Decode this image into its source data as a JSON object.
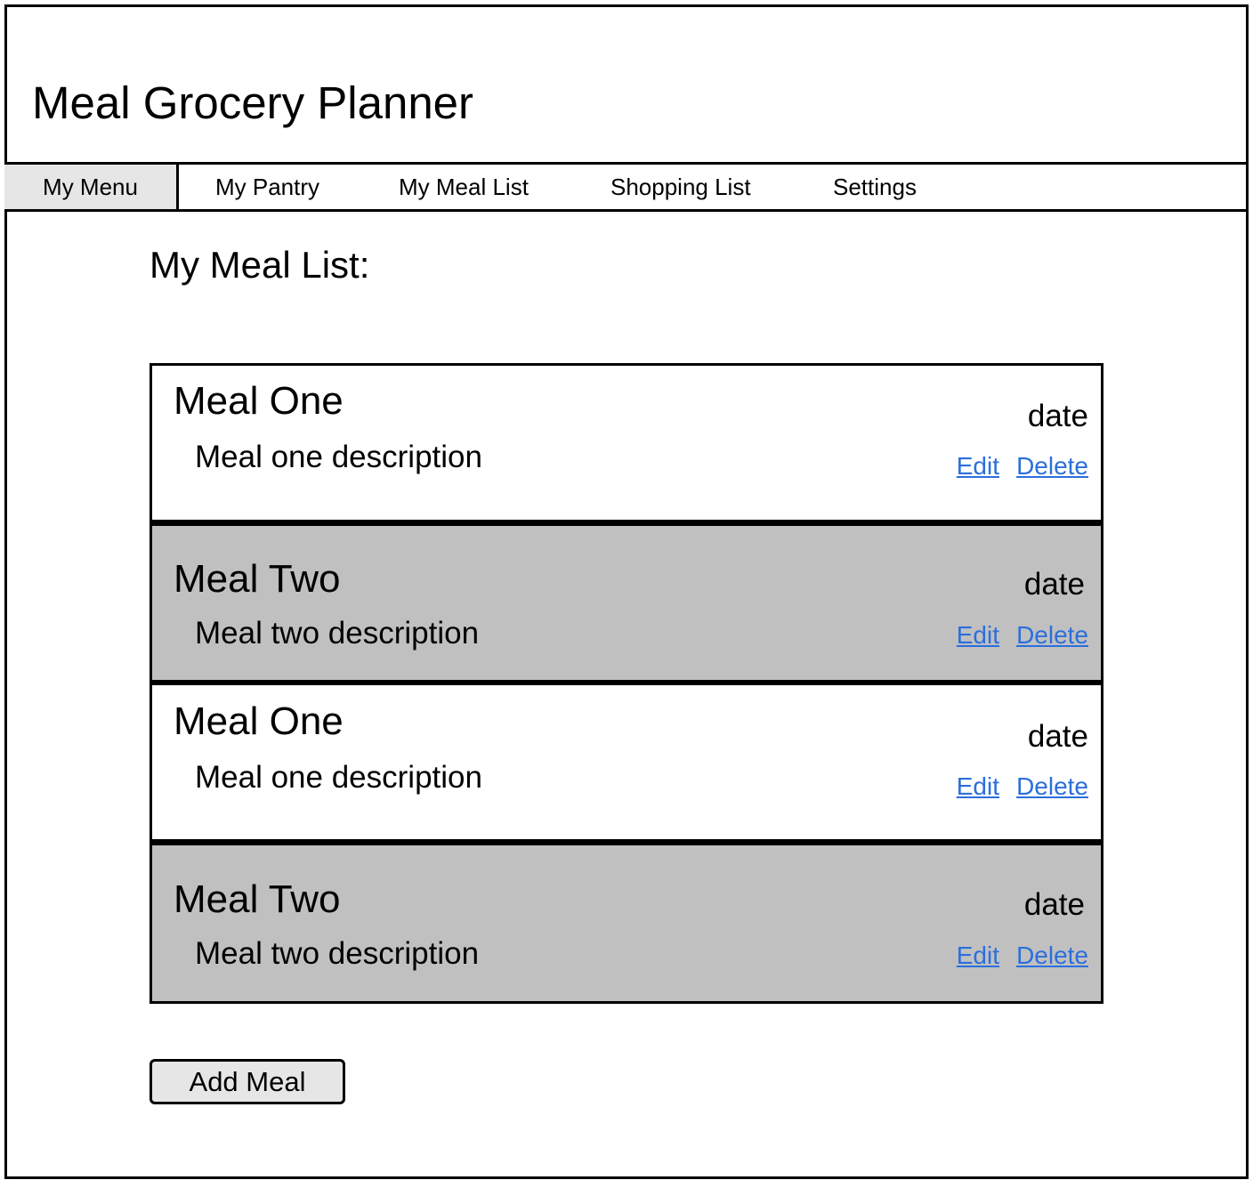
{
  "app": {
    "title": "Meal Grocery Planner"
  },
  "nav": {
    "tabs": [
      {
        "label": "My Menu",
        "active": true
      },
      {
        "label": "My Pantry",
        "active": false
      },
      {
        "label": "My Meal List",
        "active": false
      },
      {
        "label": "Shopping List",
        "active": false
      },
      {
        "label": "Settings",
        "active": false
      }
    ]
  },
  "main": {
    "heading": "My Meal List:",
    "meals": [
      {
        "name": "Meal One",
        "description": "Meal one description",
        "date": "date",
        "edit_label": "Edit",
        "delete_label": "Delete"
      },
      {
        "name": "Meal Two",
        "description": "Meal two description",
        "date": "date",
        "edit_label": "Edit",
        "delete_label": "Delete"
      },
      {
        "name": "Meal One",
        "description": "Meal one description",
        "date": "date",
        "edit_label": "Edit",
        "delete_label": "Delete"
      },
      {
        "name": "Meal Two",
        "description": "Meal two description",
        "date": "date",
        "edit_label": "Edit",
        "delete_label": "Delete"
      }
    ],
    "add_button_label": "Add Meal"
  },
  "colors": {
    "link": "#2b6fdd",
    "active_tab_bg": "#e6e6e6",
    "alt_row_bg": "#c0c0c0",
    "button_bg": "#e6e6e6"
  }
}
